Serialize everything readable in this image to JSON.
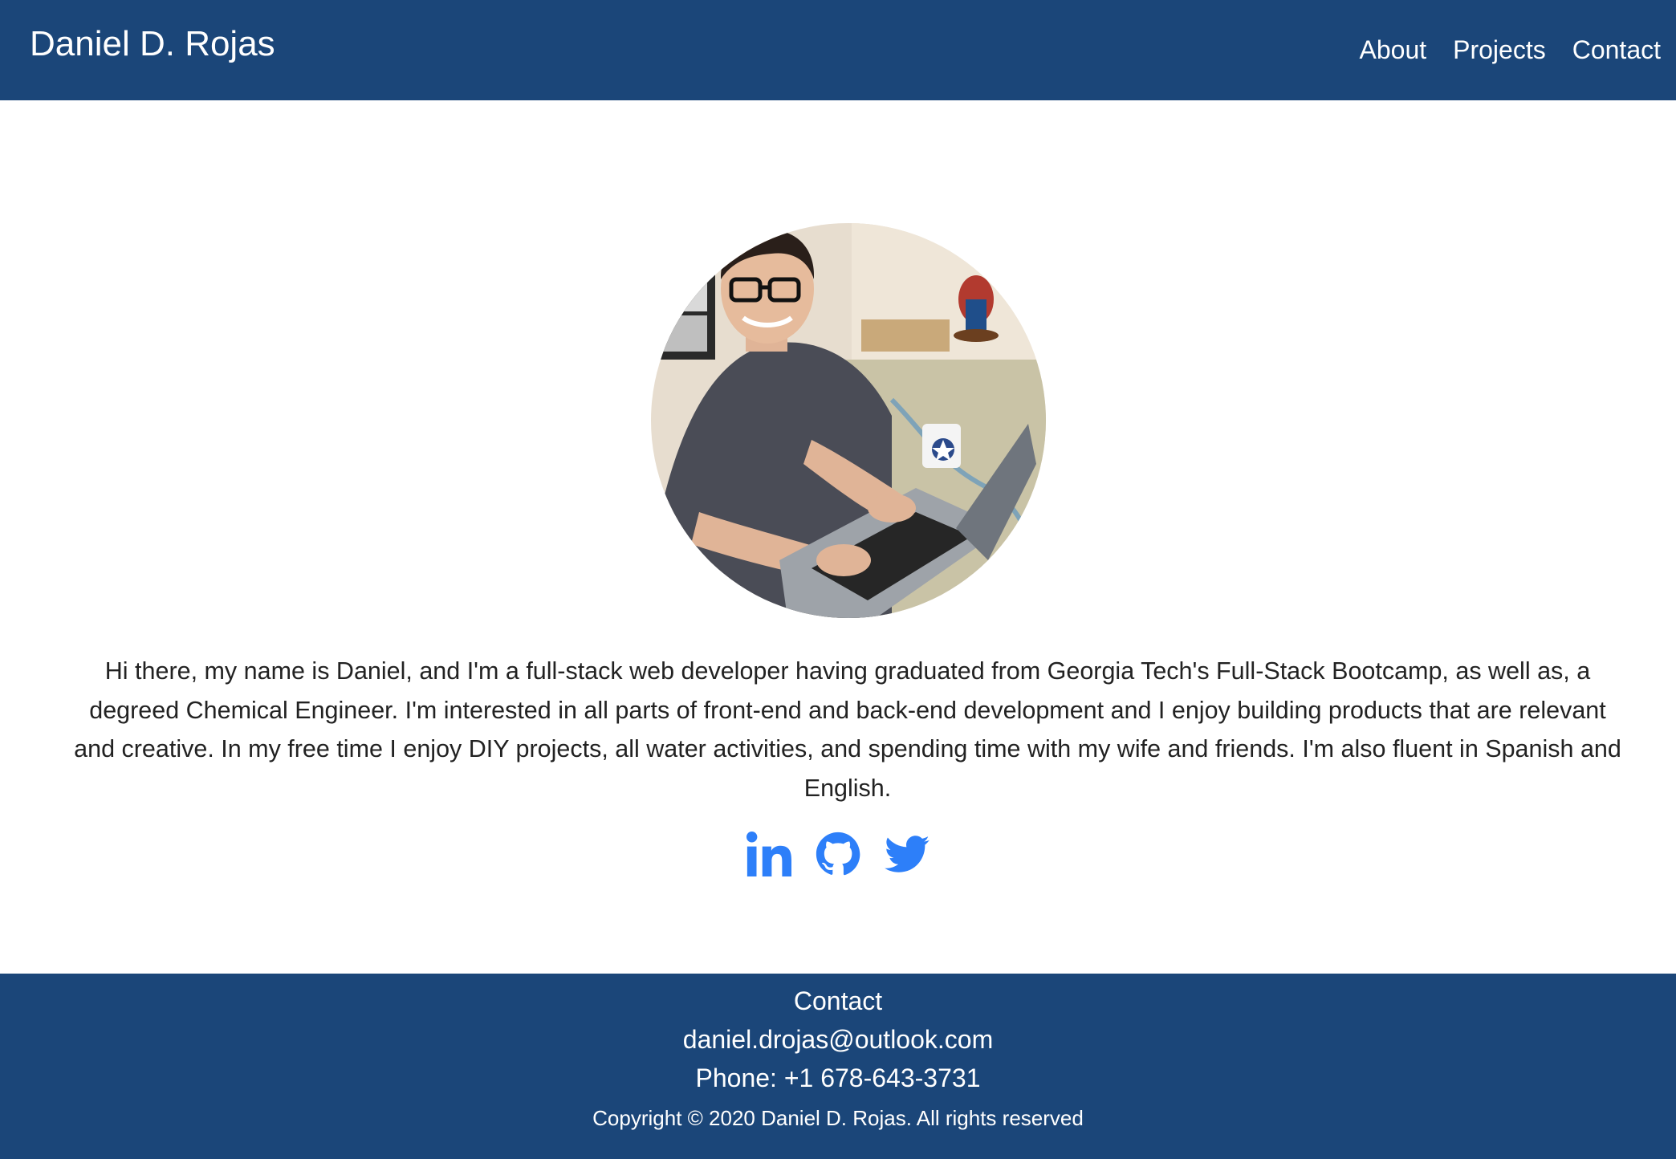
{
  "header": {
    "brand": "Daniel D. Rojas",
    "nav": [
      {
        "label": "About"
      },
      {
        "label": "Projects"
      },
      {
        "label": "Contact"
      }
    ]
  },
  "about": {
    "bio": "Hi there, my name is Daniel, and I'm a full-stack web developer having graduated from Georgia Tech's Full-Stack Bootcamp, as well as, a degreed Chemical Engineer. I'm interested in all parts of front-end and back-end development and I enjoy building products that are relevant and creative. In my free time I enjoy DIY projects, all water activities, and spending time with my wife and friends. I'm also fluent in Spanish and English.",
    "social": [
      {
        "icon": "linkedin-icon"
      },
      {
        "icon": "github-icon"
      },
      {
        "icon": "twitter-icon"
      }
    ]
  },
  "footer": {
    "title": "Contact",
    "email": "daniel.drojas@outlook.com",
    "phone": "Phone: +1 678-643-3731",
    "copyright": "Copyright © 2020 Daniel D. Rojas. All rights reserved"
  },
  "colors": {
    "navy": "#1b4679",
    "icon_blue": "#2d7ff9",
    "body_text": "#222222"
  }
}
